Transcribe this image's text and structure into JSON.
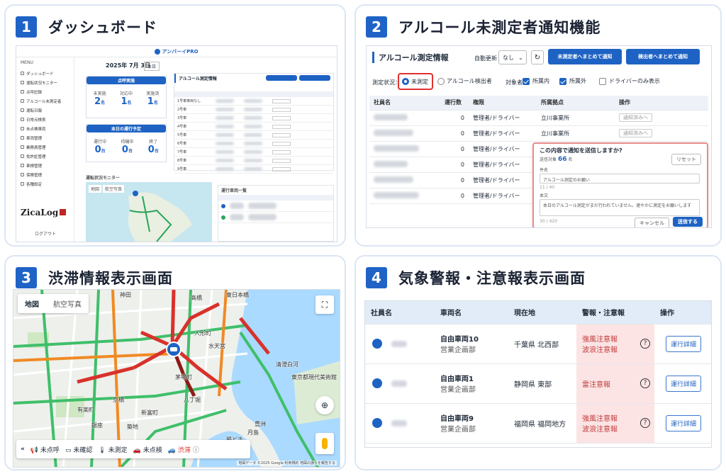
{
  "panels": [
    {
      "num": "1",
      "title": "ダッシュボード"
    },
    {
      "num": "2",
      "title": "アルコール未測定者通知機能"
    },
    {
      "num": "3",
      "title": "渋滞情報表示画面"
    },
    {
      "num": "4",
      "title": "気象警報・注意報表示画面"
    }
  ],
  "dashboard": {
    "logo": "アンバーイPRO",
    "date": "2025年 7月 3日",
    "today_btn": "本日",
    "menu_label": "MENU",
    "menu_items": [
      "ダッシュボード",
      "運転状況モニター",
      "点呼記録",
      "アルコール未測定者",
      "運転日報",
      "日常点検表",
      "未点検車両",
      "車両管理",
      "乗務員管理",
      "免許証管理",
      "車検管理",
      "保険管理",
      "各種設定"
    ],
    "card1_title": "点呼実施",
    "card2_title": "本日の運行予定",
    "card_stats": [
      {
        "label": "未実施",
        "value": "2",
        "unit": "名"
      },
      {
        "label": "対応中",
        "value": "1",
        "unit": "名"
      },
      {
        "label": "実施済",
        "value": "1",
        "unit": "名"
      }
    ],
    "card_stats2": [
      {
        "label": "運行中",
        "value": "0",
        "unit": "台"
      },
      {
        "label": "待機中",
        "value": "0",
        "unit": "台"
      },
      {
        "label": "終了",
        "value": "0",
        "unit": "台"
      }
    ],
    "alcohol_title": "アルコール測定情報",
    "monitor_title": "運転状況モニター",
    "map_tabs": [
      "地図",
      "航空写真"
    ],
    "vehicle_list_title": "運行車両一覧",
    "brand": "ZicaLog",
    "logout": "ログアウト",
    "table_rows": [
      "1号車車両なし",
      "2号車",
      "3号車",
      "4号車",
      "5号車",
      "6号車",
      "7号車",
      "8号車",
      "9号車"
    ]
  },
  "alcohol": {
    "title": "アルコール測定情報",
    "auto_update_label": "自動更新",
    "auto_update_value": "なし",
    "notify_unmeasured_btn": "未測定者へまとめて通知",
    "notify_detected_btn": "検出者へまとめて通知",
    "status_label": "測定状況：",
    "opt_unmeasured": "未測定",
    "opt_detected": "アルコール検出者",
    "target_label": "対象者",
    "chk_inside": "所属内",
    "chk_outside": "所属外",
    "chk_driver_only": "ドライバーのみ表示",
    "columns": [
      "社員名",
      "運行数",
      "権限",
      "所属拠点",
      "操作"
    ],
    "rows": [
      {
        "count": "0",
        "role": "管理者/ドライバー",
        "base": "立川事業所",
        "op": "通知済みへ"
      },
      {
        "count": "0",
        "role": "管理者/ドライバー",
        "base": "立川事業所",
        "op": "通知済みへ"
      },
      {
        "count": "0",
        "role": "管理者/ドライバー",
        "base": "",
        "op": ""
      },
      {
        "count": "0",
        "role": "管理者/ドライバー",
        "base": "",
        "op": ""
      },
      {
        "count": "0",
        "role": "管理者/ドライバー",
        "base": "",
        "op": ""
      },
      {
        "count": "0",
        "role": "管理者/ドライバー",
        "base": "",
        "op": ""
      }
    ],
    "dialog": {
      "title": "この内容で通知を送信しますか?",
      "recipients_label": "送信対象",
      "recipients_count": "66",
      "recipients_unit": "名",
      "reset": "リセット",
      "subject_label": "件名",
      "subject_value": "アルコール測定のお願い",
      "subject_counter": "11 / 40",
      "body_label": "本文",
      "body_value": "本日のアルコール測定がまだ行われていません。速やかに測定をお願いします",
      "body_counter": "30 / 420",
      "cancel": "キャンセル",
      "send": "送信する"
    }
  },
  "traffic": {
    "map_tabs": [
      "地図",
      "航空写真"
    ],
    "labels": [
      "神田",
      "高橋",
      "東日本橋",
      "人形町",
      "水天宮",
      "清澄白河",
      "東京都現代美術館",
      "豊洲",
      "勝どき",
      "月島",
      "築地",
      "新富町",
      "八丁堀",
      "茅場町",
      "京橋",
      "有楽町",
      "銀座"
    ],
    "legend": [
      {
        "icon": "phone",
        "label": "未点呼"
      },
      {
        "icon": "card",
        "label": "未確認"
      },
      {
        "icon": "thermo",
        "label": "未測定"
      },
      {
        "icon": "car",
        "label": "未点検"
      },
      {
        "icon": "jam",
        "label": "渋滞"
      }
    ],
    "footer": "地図データ ©2025 Google  利用規約  地図の誤りを報告する"
  },
  "weather": {
    "columns": [
      "社員名",
      "車両名",
      "現在地",
      "警報・注意報",
      "操作"
    ],
    "rows": [
      {
        "vehicle": "自由車両10",
        "dept": "営業企画部",
        "location": "千葉県 北西部",
        "alerts": [
          "強風注意報",
          "波浪注意報"
        ],
        "action": "運行詳細"
      },
      {
        "vehicle": "自由車両1",
        "dept": "営業企画部",
        "location": "静岡県 東部",
        "alerts": [
          "雷注意報"
        ],
        "action": "運行詳細"
      },
      {
        "vehicle": "自由車両9",
        "dept": "営業企画部",
        "location": "福岡県 福岡地方",
        "alerts": [
          "強風注意報",
          "波浪注意報"
        ],
        "action": "運行詳細"
      }
    ]
  }
}
